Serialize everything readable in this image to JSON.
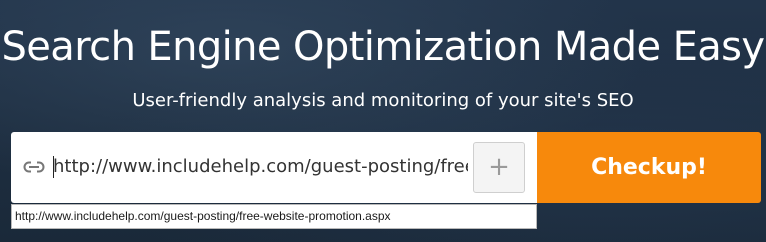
{
  "hero": {
    "title": "Search Engine Optimization Made Easy",
    "subtitle": "User-friendly analysis and monitoring of your site's SEO"
  },
  "search": {
    "url_value": "http://www.includehelp.com/guest-posting/free-",
    "link_icon": "link-icon",
    "add_button_label": "+",
    "submit_label": "Checkup!",
    "suggestion": "http://www.includehelp.com/guest-posting/free-website-promotion.aspx"
  },
  "colors": {
    "background": "#1d2c3d",
    "accent": "#f7890c",
    "text_on_dark": "#ffffff"
  }
}
